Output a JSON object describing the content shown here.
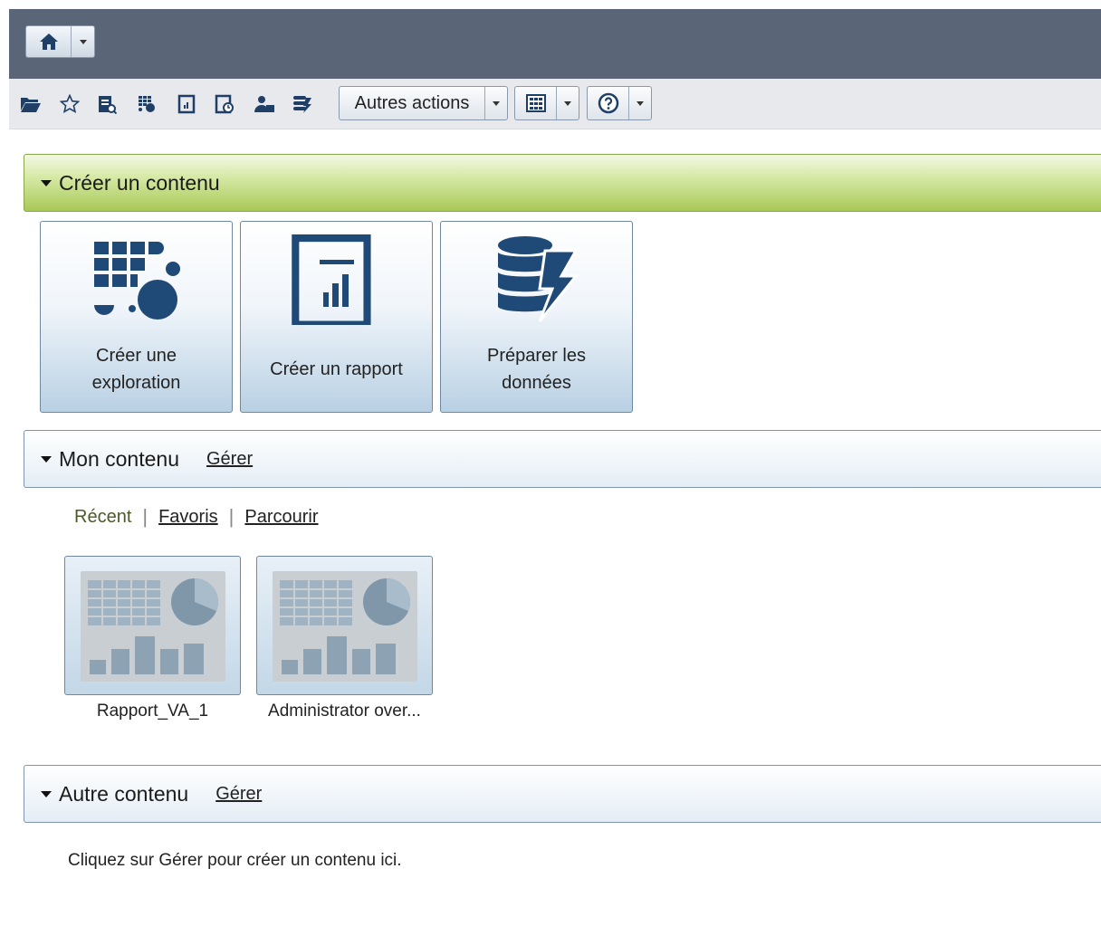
{
  "toolbar": {
    "icons": [
      "folder-open-icon",
      "star-icon",
      "report-view-icon",
      "explorer-icon",
      "report-icon",
      "schedule-icon",
      "users-icon",
      "data-icon"
    ],
    "more_actions_label": "Autres actions"
  },
  "create_section": {
    "title": "Créer un contenu",
    "tiles": [
      {
        "label": "Créer une\nexploration"
      },
      {
        "label": "Créer un rapport"
      },
      {
        "label": "Préparer les\ndonnées"
      }
    ]
  },
  "my_content": {
    "title": "Mon contenu",
    "manage_label": "Gérer",
    "tabs": {
      "recent": "Récent",
      "favorites": "Favoris",
      "browse": "Parcourir"
    },
    "items": [
      {
        "label": "Rapport_VA_1"
      },
      {
        "label": "Administrator over..."
      }
    ]
  },
  "other_content": {
    "title": "Autre contenu",
    "manage_label": "Gérer",
    "empty_message": "Cliquez sur Gérer pour créer un contenu ici."
  },
  "colors": {
    "header_bg": "#5b6578",
    "toolbar_bg": "#e7e9ec",
    "accent_green": "#a8c957",
    "tile_blue": "#b8d0e3",
    "icon_dark": "#1f4a78"
  }
}
